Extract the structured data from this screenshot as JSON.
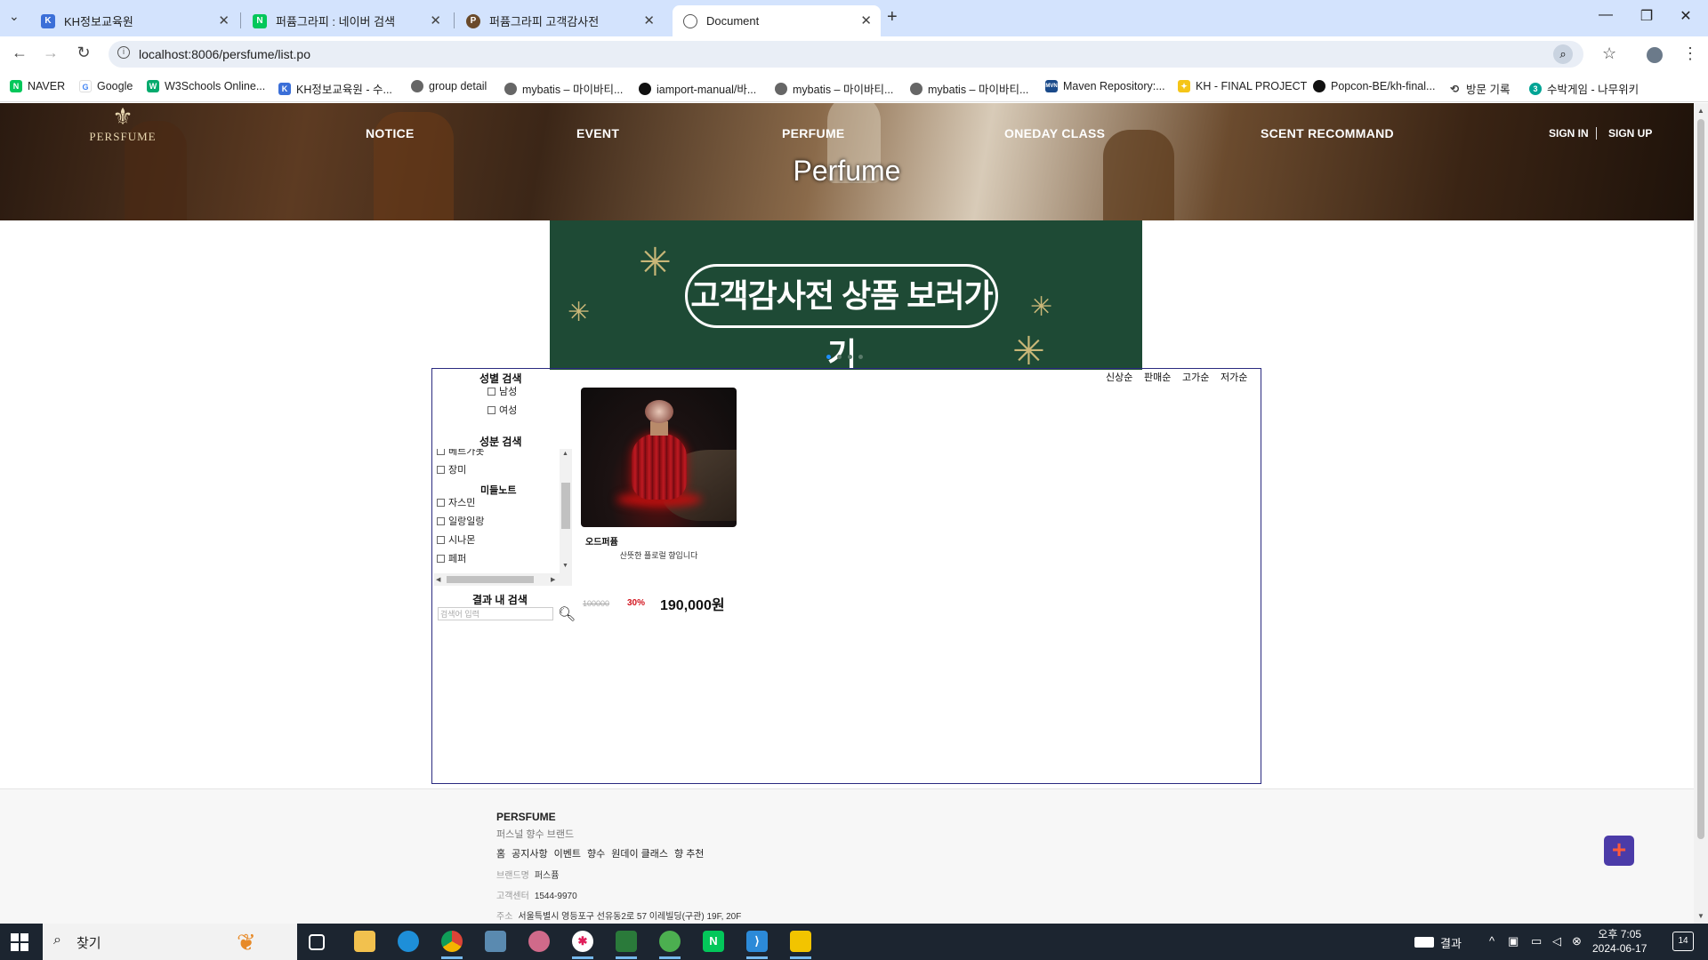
{
  "browser": {
    "tabs": [
      {
        "title": "KH정보교육원",
        "active": false
      },
      {
        "title": "퍼퓸그라피 : 네이버 검색",
        "active": false
      },
      {
        "title": "퍼퓸그라피 고객감사전",
        "active": false
      },
      {
        "title": "Document",
        "active": true
      }
    ],
    "url": "localhost:8006/persfume/list.po",
    "bookmarks": [
      "NAVER",
      "Google",
      "W3Schools Online...",
      "KH정보교육원 - 수...",
      "group detail",
      "mybatis – 마이바티...",
      "iamport-manual/바...",
      "mybatis – 마이바티...",
      "mybatis – 마이바티...",
      "Maven Repository:...",
      "KH - FINAL PROJECT",
      "Popcon-BE/kh-final...",
      "방문 기록",
      "수박게임 - 나무위키"
    ]
  },
  "header": {
    "logo_text": "PERSFUME",
    "nav": [
      "NOTICE",
      "EVENT",
      "PERFUME",
      "ONEDAY CLASS",
      "SCENT RECOMMAND"
    ],
    "sign_in": "SIGN IN",
    "sign_up": "SIGN UP",
    "page_title": "Perfume"
  },
  "banner": {
    "text": "고객감사전 상품 보러가기",
    "slide_count": 4,
    "active_slide": 1
  },
  "filters": {
    "gender_title": "성별 검색",
    "gender_options": [
      "남성",
      "여성"
    ],
    "ingredient_title": "성분 검색",
    "ingredient_partial": "베르가못",
    "ingredient_top": [
      "장미"
    ],
    "middle_note_title": "미들노트",
    "middle_notes": [
      "자스민",
      "일랑일랑",
      "시나몬",
      "페퍼"
    ],
    "result_search_title": "결과 내 검색",
    "search_placeholder": "검색어 입력"
  },
  "sort_options": [
    "신상순",
    "판매순",
    "고가순",
    "저가순"
  ],
  "product": {
    "name": "오드퍼퓸",
    "description": "산뜻한 플로럴 향입니다",
    "original_price": "100000",
    "discount": "30%",
    "price": "190,000원"
  },
  "footer": {
    "brand": "PERSFUME",
    "tagline": "퍼스널 향수 브랜드",
    "links": [
      "홈",
      "공지사항",
      "이벤트",
      "향수",
      "원데이 클래스",
      "향 추천"
    ],
    "brand_label": "브랜드명",
    "brand_value": "퍼스퓸",
    "center_label": "고객센터",
    "center_value": "1544-9970",
    "address_label": "주소",
    "address_value": "서울특별시 영등포구 선유동2로 57 이레빌딩(구관) 19F, 20F"
  },
  "taskbar": {
    "search_text": "찾기",
    "tray_label": "결과",
    "time": "오후 7:05",
    "date": "2024-06-17",
    "notification_count": "14"
  }
}
